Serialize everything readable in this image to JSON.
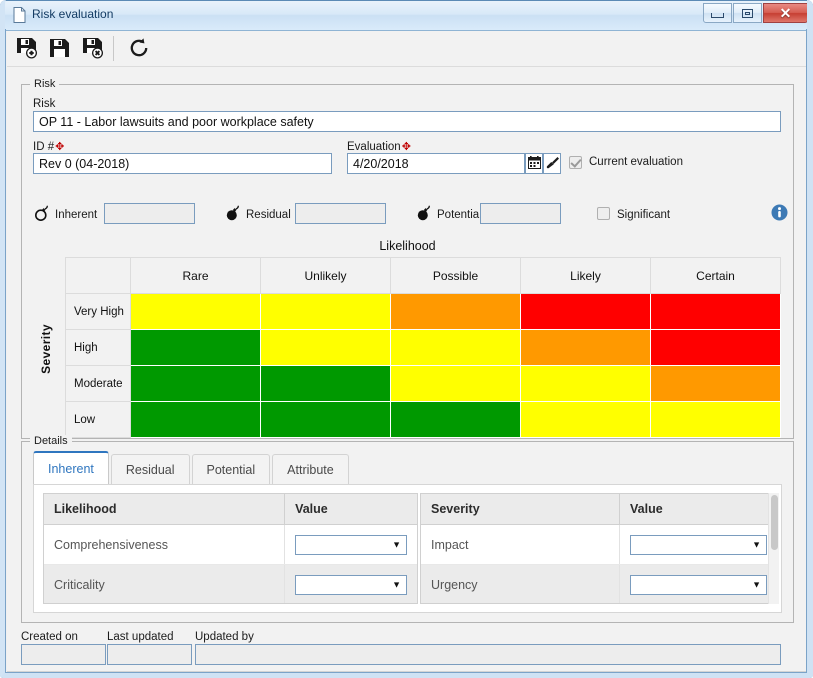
{
  "window": {
    "title": "Risk evaluation",
    "title_icon": "document-icon",
    "buttons": {
      "minimize": "minimize-icon",
      "maximize": "maximize-icon",
      "close": "✕"
    }
  },
  "toolbar": {
    "items": [
      {
        "name": "save-and-new-button",
        "icon": "save-new-icon",
        "tooltip": "Save and new"
      },
      {
        "name": "save-button",
        "icon": "save-icon",
        "tooltip": "Save"
      },
      {
        "name": "save-and-close-button",
        "icon": "save-close-icon",
        "tooltip": "Save and close"
      },
      {
        "name": "refresh-button",
        "icon": "refresh-icon",
        "tooltip": "Refresh"
      }
    ]
  },
  "risk_group": {
    "legend": "Risk",
    "risk_label": "Risk",
    "risk_value": "OP 11 - Labor lawsuits and poor workplace safety",
    "id_label": "ID #",
    "id_required": "✥",
    "id_value": "Rev 0 (04-2018)",
    "evaluation_label": "Evaluation",
    "evaluation_required": "✥",
    "evaluation_value": "4/20/2018",
    "calendar_icon": "calendar-icon",
    "clear_icon": "brush-icon",
    "current_evaluation_label": "Current evaluation",
    "current_evaluation_checked": true,
    "scores": [
      {
        "name": "inherent",
        "icon": "bomb-icon",
        "label": "Inherent",
        "value": ""
      },
      {
        "name": "residual",
        "icon": "bomb-lit-icon",
        "label": "Residual",
        "value": ""
      },
      {
        "name": "potential",
        "icon": "bomb-lit-icon",
        "label": "Potential",
        "value": ""
      }
    ],
    "significant_label": "Significant",
    "significant_checked": false,
    "info_icon": "info-icon"
  },
  "matrix": {
    "x_axis_title": "Likelihood",
    "y_axis_title": "Severity",
    "columns": [
      "Rare",
      "Unlikely",
      "Possible",
      "Likely",
      "Certain"
    ],
    "rows": [
      "Very High",
      "High",
      "Moderate",
      "Low"
    ],
    "colors": {
      "green": "#009900",
      "yellow": "#FFFF00",
      "orange": "#FF9900",
      "red": "#FF0000"
    },
    "cells": [
      [
        "yellow",
        "yellow",
        "orange",
        "red",
        "red"
      ],
      [
        "green",
        "yellow",
        "yellow",
        "orange",
        "red"
      ],
      [
        "green",
        "green",
        "yellow",
        "yellow",
        "orange"
      ],
      [
        "green",
        "green",
        "green",
        "yellow",
        "yellow"
      ]
    ]
  },
  "details": {
    "legend": "Details",
    "tabs": [
      {
        "label": "Inherent",
        "active": true
      },
      {
        "label": "Residual",
        "active": false
      },
      {
        "label": "Potential",
        "active": false
      },
      {
        "label": "Attribute",
        "active": false
      }
    ],
    "likelihood_grid": {
      "headers": [
        "Likelihood",
        "Value"
      ],
      "rows": [
        {
          "label": "Comprehensiveness",
          "value": ""
        },
        {
          "label": "Criticality",
          "value": ""
        }
      ]
    },
    "severity_grid": {
      "headers": [
        "Severity",
        "Value"
      ],
      "rows": [
        {
          "label": "Impact",
          "value": ""
        },
        {
          "label": "Urgency",
          "value": ""
        }
      ]
    }
  },
  "footer": {
    "created_on_label": "Created on",
    "created_on_value": "",
    "last_updated_label": "Last updated",
    "last_updated_value": "",
    "updated_by_label": "Updated by",
    "updated_by_value": ""
  }
}
